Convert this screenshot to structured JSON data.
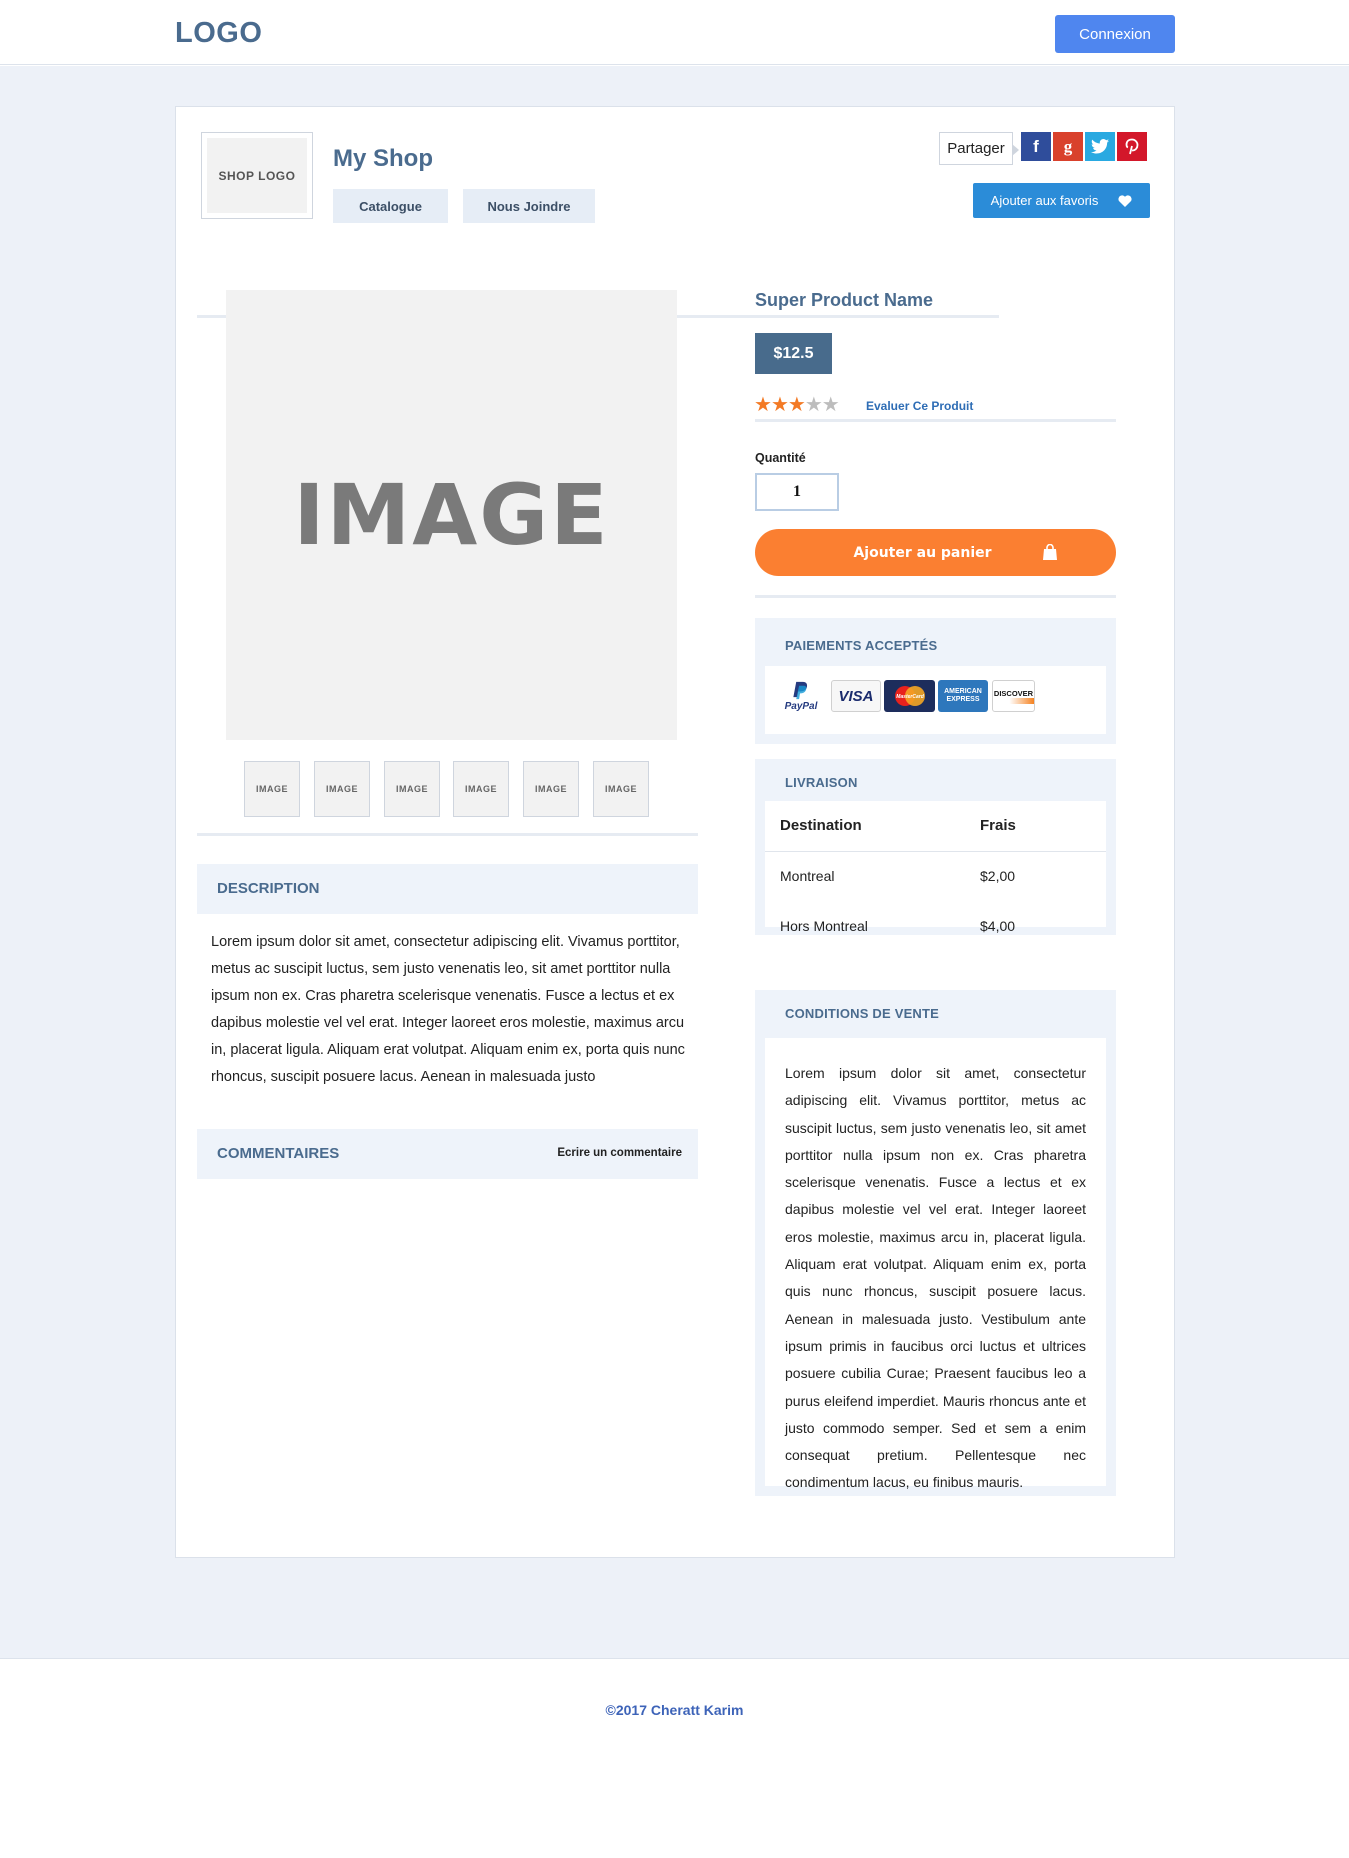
{
  "header": {
    "logo": "LOGO",
    "login_label": "Connexion"
  },
  "shop": {
    "logo_text": "SHOP LOGO",
    "name": "My Shop",
    "tabs": [
      "Catalogue",
      "Nous Joindre"
    ],
    "share_label": "Partager",
    "social": [
      {
        "icon": "facebook-icon",
        "glyph": "f",
        "color": "#2f4d9b"
      },
      {
        "icon": "google-plus-icon",
        "glyph": "g",
        "color": "#d9412c"
      },
      {
        "icon": "twitter-icon",
        "glyph": "t",
        "color": "#29a9e1"
      },
      {
        "icon": "pinterest-icon",
        "glyph": "p",
        "color": "#d3172a"
      }
    ],
    "favorite_label": "Ajouter aux favoris"
  },
  "gallery": {
    "main_label": "IMAGE",
    "thumbs": [
      "IMAGE",
      "IMAGE",
      "IMAGE",
      "IMAGE",
      "IMAGE",
      "IMAGE"
    ]
  },
  "product": {
    "name": "Super Product Name",
    "price": "$12.5",
    "rating": 3,
    "rating_max": 5,
    "rate_link": "Evaluer Ce Produit",
    "quantity_label": "Quantité",
    "quantity": "1",
    "add_to_cart": "Ajouter au panier"
  },
  "description": {
    "title": "DESCRIPTION",
    "text": "Lorem ipsum dolor sit amet, consectetur adipiscing elit. Vivamus porttitor, metus ac suscipit luctus, sem justo venenatis leo, sit amet porttitor nulla ipsum non ex. Cras pharetra scelerisque venenatis. Fusce a lectus et ex dapibus molestie vel vel erat. Integer laoreet eros molestie, maximus arcu in, placerat ligula. Aliquam erat volutpat. Aliquam enim ex, porta quis nunc rhoncus, suscipit posuere lacus. Aenean in malesuada justo"
  },
  "comments": {
    "title": "COMMENTAIRES",
    "write_label": "Ecrire un commentaire"
  },
  "payments": {
    "title": "PAIEMENTS ACCEPTÉS",
    "methods": [
      "PayPal",
      "VISA",
      "MasterCard",
      "AMERICAN EXPRESS",
      "DISCOVER"
    ]
  },
  "shipping": {
    "title": "LIVRAISON",
    "columns": [
      "Destination",
      "Frais"
    ],
    "rows": [
      [
        "Montreal",
        "$2,00"
      ],
      [
        "Hors Montreal",
        "$4,00"
      ]
    ]
  },
  "conditions": {
    "title": "CONDITIONS DE VENTE",
    "text": "Lorem ipsum dolor sit amet, consectetur adipiscing elit. Vivamus porttitor, metus ac suscipit luctus, sem justo venenatis leo, sit amet porttitor nulla ipsum non ex. Cras pharetra scelerisque venenatis. Fusce a lectus et ex dapibus molestie vel vel erat. Integer laoreet eros molestie, maximus arcu in, placerat ligula. Aliquam erat volutpat. Aliquam enim ex, porta quis nunc rhoncus, suscipit posuere lacus. Aenean in malesuada justo. Vestibulum ante ipsum primis in faucibus orci luctus et ultrices posuere cubilia Curae; Praesent faucibus leo a purus eleifend imperdiet. Mauris rhoncus ante et justo commodo semper. Sed et sem a enim consequat pretium. Pellentesque nec condimentum lacus, eu finibus mauris."
  },
  "footer": {
    "copyright": "©2017  Cheratt Karim"
  },
  "colors": {
    "accent": "#4a6b8e",
    "login": "#4f86ef",
    "cart": "#fb7f31",
    "price": "#486b8c"
  }
}
